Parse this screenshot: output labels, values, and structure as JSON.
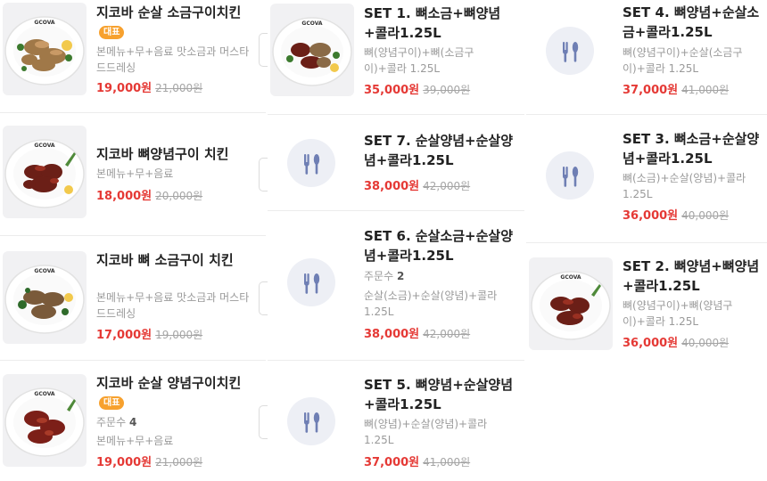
{
  "accent_price_color": "#e53935",
  "badge_color": "#f7a12e",
  "items": [
    {
      "title": "지코바 순살 소금구이치킨",
      "badge": "대표",
      "desc": "본메뉴+무+음료 맛소금과 머스타드드레싱",
      "price": "19,000원",
      "old": "21,000원",
      "image": "photo-salt-chicken"
    },
    {
      "title": "지코바 뼈양념구이 치킨",
      "desc": "본메뉴+무+음료",
      "price": "18,000원",
      "old": "20,000원",
      "image": "photo-spicy-chicken"
    },
    {
      "title": "지코바 뼈 소금구이 치킨",
      "desc": "본메뉴+무+음료 맛소금과 머스타드드레싱",
      "price": "17,000원",
      "old": "19,000원",
      "image": "photo-salt-bone-chicken"
    },
    {
      "title": "지코바 순살 양념구이치킨",
      "badge": "대표",
      "orders_label": "주문수",
      "orders": "4",
      "desc": "본메뉴+무+음료",
      "price": "19,000원",
      "old": "21,000원",
      "image": "photo-spicy-boneless-chicken"
    },
    {
      "title": "SET 1. 뼈소금+뼈양념+콜라1.25L",
      "desc": "뼈(양념구이)+뼈(소금구이)+콜라 1.25L",
      "price": "35,000원",
      "old": "39,000원",
      "image": "photo-set1"
    },
    {
      "title": "SET 7. 순살양념+순살양념+콜라1.25L",
      "price": "38,000원",
      "old": "42,000원",
      "image": "utensils-icon"
    },
    {
      "title": "SET 6. 순살소금+순살양념+콜라1.25L",
      "orders_label": "주문수",
      "orders": "2",
      "desc": "순살(소금)+순살(양념)+콜라1.25L",
      "price": "38,000원",
      "old": "42,000원",
      "image": "utensils-icon"
    },
    {
      "title": "SET 5. 뼈양념+순살양념+콜라1.25L",
      "desc": "뼈(양념)+순살(양념)+콜라1.25L",
      "price": "37,000원",
      "old": "41,000원",
      "image": "utensils-icon"
    },
    {
      "title": "SET 4. 뼈양념+순살소금+콜라1.25L",
      "desc": "뼈(양념구이)+순살(소금구이)+콜라 1.25L",
      "price": "37,000원",
      "old": "41,000원",
      "image": "utensils-icon"
    },
    {
      "title": "SET 3. 뼈소금+순살양념+콜라1.25L",
      "desc": "뼈(소금)+순살(양념)+콜라1.25L",
      "price": "36,000원",
      "old": "40,000원",
      "image": "utensils-icon"
    },
    {
      "title": "SET 2. 뼈양념+뼈양념+콜라1.25L",
      "desc": "뼈(양념구이)+뼈(양념구이)+콜라 1.25L",
      "price": "36,000원",
      "old": "40,000원",
      "image": "photo-set2"
    }
  ]
}
